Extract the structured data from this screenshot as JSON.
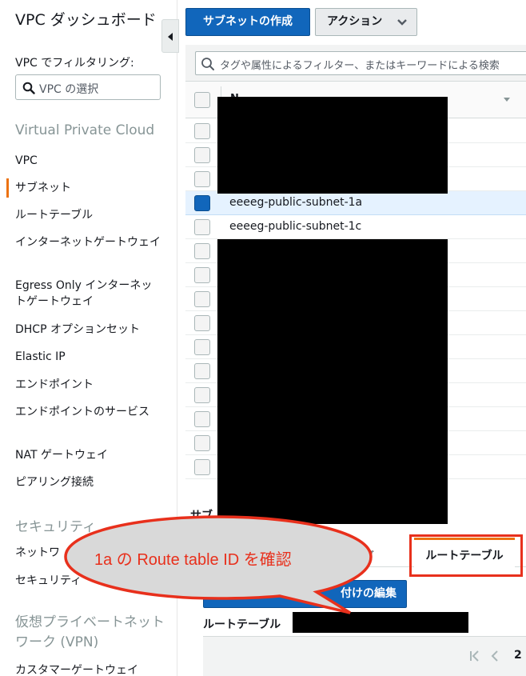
{
  "sidebar": {
    "title": "VPC ダッシュボード",
    "filter_label": "VPC でフィルタリング:",
    "vpc_select_placeholder": "VPC の選択",
    "section_vpc": "Virtual Private Cloud",
    "items": [
      {
        "label": "VPC"
      },
      {
        "label": "サブネット"
      },
      {
        "label": "ルートテーブル"
      },
      {
        "label": "インターネットゲートウェイ"
      },
      {
        "label": "Egress Only インターネットゲートウェイ"
      },
      {
        "label": "DHCP オプションセット"
      },
      {
        "label": "Elastic IP"
      },
      {
        "label": "エンドポイント"
      },
      {
        "label": "エンドポイントのサービス"
      },
      {
        "label": "NAT ゲートウェイ"
      },
      {
        "label": "ピアリング接続"
      }
    ],
    "section_security": "セキュリティ",
    "security_items": [
      {
        "label": "ネットワ"
      },
      {
        "label": "セキュリティ"
      }
    ],
    "section_vpn": "仮想プライベートネットワーク (VPN)",
    "vpn_items": [
      {
        "label": "カスタマーゲートウェイ"
      }
    ]
  },
  "toolbar": {
    "create_subnet_label": "サブネットの作成",
    "actions_label": "アクション"
  },
  "filter": {
    "placeholder": "タグや属性によるフィルター、またはキーワードによる検索"
  },
  "table": {
    "column_name": "N",
    "rows": [
      {
        "name": "",
        "selected": false
      },
      {
        "name": "",
        "selected": false
      },
      {
        "name": "",
        "selected": false
      },
      {
        "name": "eeeeg-public-subnet-1a",
        "selected": true
      },
      {
        "name": "eeeeg-public-subnet-1c",
        "selected": false
      },
      {
        "name": "",
        "selected": false
      },
      {
        "name": "",
        "selected": false
      },
      {
        "name": "",
        "selected": false
      },
      {
        "name": "",
        "selected": false
      },
      {
        "name": "",
        "selected": false
      },
      {
        "name": "",
        "selected": false
      },
      {
        "name": "",
        "selected": false
      },
      {
        "name": "",
        "selected": false
      },
      {
        "name": "",
        "selected": false
      },
      {
        "name": "",
        "selected": false
      }
    ]
  },
  "details": {
    "title": "サブ",
    "tab_log": "ログ",
    "tab_route_table": "ルートテーブル",
    "edit_button": "付けの編集",
    "route_table_label": "ルートテーブル",
    "page_number": "2"
  },
  "annotation": {
    "callout_text": "1a の Route table ID を確認",
    "color": "#e8301c"
  },
  "colors": {
    "primary": "#1166bb",
    "accent": "#ec7211",
    "redaction": "#000000"
  }
}
